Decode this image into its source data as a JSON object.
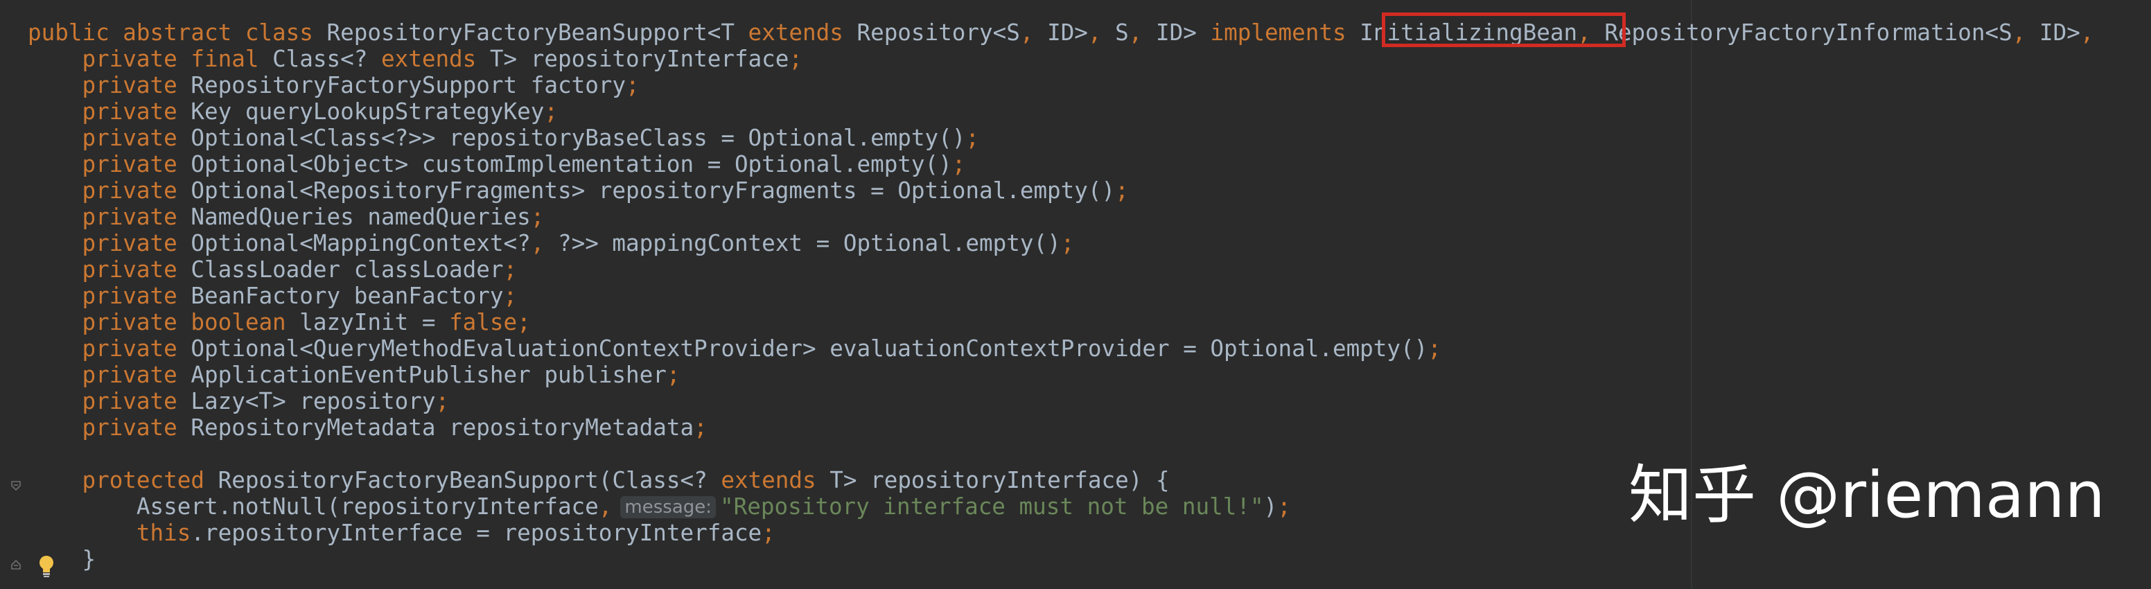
{
  "editor": {
    "code_lines": [
      [
        [
          "kw",
          "public abstract class "
        ],
        [
          "t",
          "RepositoryFactoryBeanSupport<T "
        ],
        [
          "kw",
          "extends "
        ],
        [
          "t",
          "Repository<S"
        ],
        [
          "punc",
          ", "
        ],
        [
          "t",
          "ID>"
        ],
        [
          "punc",
          ", "
        ],
        [
          "t",
          "S"
        ],
        [
          "punc",
          ", "
        ],
        [
          "t",
          "ID> "
        ],
        [
          "kw",
          "implements "
        ],
        [
          "t",
          "InitializingBean"
        ],
        [
          "punc",
          ", "
        ],
        [
          "t",
          "RepositoryFactoryInformation<S"
        ],
        [
          "punc",
          ", "
        ],
        [
          "t",
          "ID>"
        ],
        [
          "punc",
          ","
        ]
      ],
      [
        [
          "t",
          "    "
        ],
        [
          "kw",
          "private final "
        ],
        [
          "t",
          "Class<? "
        ],
        [
          "kw",
          "extends "
        ],
        [
          "t",
          "T> repositoryInterface"
        ],
        [
          "punc",
          ";"
        ]
      ],
      [
        [
          "t",
          "    "
        ],
        [
          "kw",
          "private "
        ],
        [
          "t",
          "RepositoryFactorySupport factory"
        ],
        [
          "punc",
          ";"
        ]
      ],
      [
        [
          "t",
          "    "
        ],
        [
          "kw",
          "private "
        ],
        [
          "t",
          "Key queryLookupStrategyKey"
        ],
        [
          "punc",
          ";"
        ]
      ],
      [
        [
          "t",
          "    "
        ],
        [
          "kw",
          "private "
        ],
        [
          "t",
          "Optional<Class<?>> repositoryBaseClass = Optional."
        ],
        [
          "t",
          "empty"
        ],
        [
          "t",
          "()"
        ],
        [
          "punc",
          ";"
        ]
      ],
      [
        [
          "t",
          "    "
        ],
        [
          "kw",
          "private "
        ],
        [
          "t",
          "Optional<Object> customImplementation = Optional."
        ],
        [
          "t",
          "empty"
        ],
        [
          "t",
          "()"
        ],
        [
          "punc",
          ";"
        ]
      ],
      [
        [
          "t",
          "    "
        ],
        [
          "kw",
          "private "
        ],
        [
          "t",
          "Optional<RepositoryFragments> repositoryFragments = Optional."
        ],
        [
          "t",
          "empty"
        ],
        [
          "t",
          "()"
        ],
        [
          "punc",
          ";"
        ]
      ],
      [
        [
          "t",
          "    "
        ],
        [
          "kw",
          "private "
        ],
        [
          "t",
          "NamedQueries namedQueries"
        ],
        [
          "punc",
          ";"
        ]
      ],
      [
        [
          "t",
          "    "
        ],
        [
          "kw",
          "private "
        ],
        [
          "t",
          "Optional<MappingContext<?"
        ],
        [
          "punc",
          ", "
        ],
        [
          "t",
          "?>> mappingContext = Optional."
        ],
        [
          "t",
          "empty"
        ],
        [
          "t",
          "()"
        ],
        [
          "punc",
          ";"
        ]
      ],
      [
        [
          "t",
          "    "
        ],
        [
          "kw",
          "private "
        ],
        [
          "t",
          "ClassLoader classLoader"
        ],
        [
          "punc",
          ";"
        ]
      ],
      [
        [
          "t",
          "    "
        ],
        [
          "kw",
          "private "
        ],
        [
          "t",
          "BeanFactory beanFactory"
        ],
        [
          "punc",
          ";"
        ]
      ],
      [
        [
          "t",
          "    "
        ],
        [
          "kw",
          "private boolean "
        ],
        [
          "t",
          "lazyInit = "
        ],
        [
          "kw",
          "false"
        ],
        [
          "punc",
          ";"
        ]
      ],
      [
        [
          "t",
          "    "
        ],
        [
          "kw",
          "private "
        ],
        [
          "t",
          "Optional<QueryMethodEvaluationContextProvider> evaluationContextProvider = Optional."
        ],
        [
          "t",
          "empty"
        ],
        [
          "t",
          "()"
        ],
        [
          "punc",
          ";"
        ]
      ],
      [
        [
          "t",
          "    "
        ],
        [
          "kw",
          "private "
        ],
        [
          "t",
          "ApplicationEventPublisher publisher"
        ],
        [
          "punc",
          ";"
        ]
      ],
      [
        [
          "t",
          "    "
        ],
        [
          "kw",
          "private "
        ],
        [
          "t",
          "Lazy<T> repository"
        ],
        [
          "punc",
          ";"
        ]
      ],
      [
        [
          "t",
          "    "
        ],
        [
          "kw",
          "private "
        ],
        [
          "t",
          "RepositoryMetadata repositoryMetadata"
        ],
        [
          "punc",
          ";"
        ]
      ],
      [
        [
          "t",
          ""
        ]
      ],
      [
        [
          "t",
          "    "
        ],
        [
          "kw",
          "protected "
        ],
        [
          "t",
          "RepositoryFactoryBeanSupport(Class<? "
        ],
        [
          "kw",
          "extends "
        ],
        [
          "t",
          "T> repositoryInterface) {"
        ]
      ],
      [
        [
          "t",
          "        Assert."
        ],
        [
          "t",
          "notNull"
        ],
        [
          "t",
          "(repositoryInterface"
        ],
        [
          "punc",
          ","
        ],
        [
          "hint",
          "message:"
        ],
        [
          "str",
          "\"Repository interface must not be null!\""
        ],
        [
          "t",
          ")"
        ],
        [
          "punc",
          ";"
        ]
      ],
      [
        [
          "t",
          "        "
        ],
        [
          "kw",
          "this"
        ],
        [
          "t",
          ".repositoryInterface = repositoryInterface"
        ],
        [
          "punc",
          ";"
        ]
      ],
      [
        [
          "t",
          "    }"
        ]
      ]
    ],
    "highlighted_token": "InitializingBean,"
  },
  "watermark": {
    "text": "知乎 @riemann"
  },
  "colors": {
    "background": "#2b2b2b",
    "keyword": "#cc7832",
    "text": "#a9b7c6",
    "string": "#6a8759",
    "highlight_border": "#d22b23"
  },
  "icons": [
    "fold-icon",
    "lightbulb-icon"
  ]
}
